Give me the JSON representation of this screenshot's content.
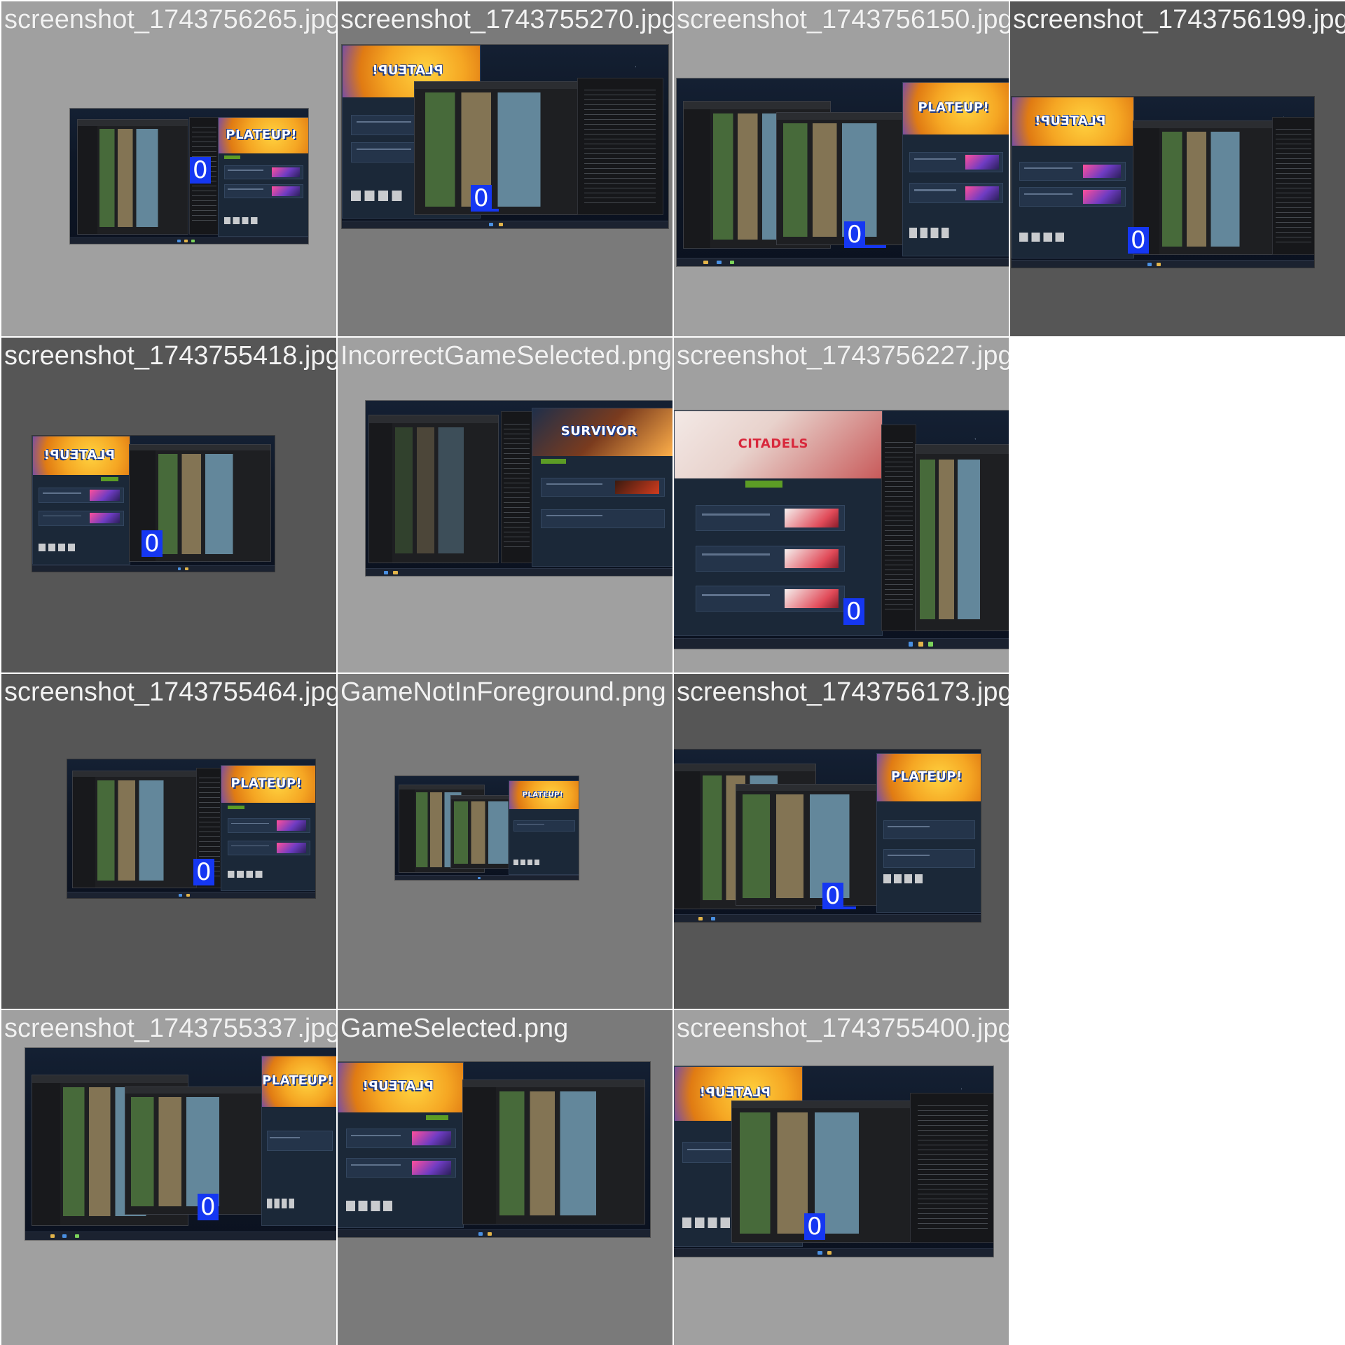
{
  "tiles": [
    {
      "filename": "screenshot_1743756265.jpg",
      "badge": "0",
      "banner": "PLATEUP!"
    },
    {
      "filename": "screenshot_1743755270.jpg",
      "badge": "0",
      "banner": "PLATEUP!"
    },
    {
      "filename": "screenshot_1743756150.jpg",
      "badge": "0",
      "banner": "PLATEUP!"
    },
    {
      "filename": "screenshot_1743756199.jpg",
      "badge": "0",
      "banner": "PLATEUP!"
    },
    {
      "filename": "screenshot_1743755418.jpg",
      "badge": "0",
      "banner": "PLATEUP!"
    },
    {
      "filename": "IncorrectGameSelected.png",
      "badge": "",
      "banner": "SURVIVOR"
    },
    {
      "filename": "screenshot_1743756227.jpg",
      "badge": "0",
      "banner": "CITADELS"
    },
    {
      "filename": "screenshot_1743755464.jpg",
      "badge": "0",
      "banner": "PLATEUP!"
    },
    {
      "filename": "GameNotInForeground.png",
      "badge": "",
      "banner": "PLATEUP!"
    },
    {
      "filename": "screenshot_1743756173.jpg",
      "badge": "0",
      "banner": "PLATEUP!"
    },
    {
      "filename": "screenshot_1743755337.jpg",
      "badge": "0",
      "banner": "PLATEUP!"
    },
    {
      "filename": "GameSelected.png",
      "badge": "",
      "banner": "PLATEUP!"
    },
    {
      "filename": "screenshot_1743755400.jpg",
      "badge": "0",
      "banner": "PLATEUP!"
    }
  ],
  "colors": {
    "badge": "#1537f2",
    "cell_light": "#a0a0a0",
    "cell_medium": "#7a7a7a",
    "cell_dark": "#565656"
  }
}
